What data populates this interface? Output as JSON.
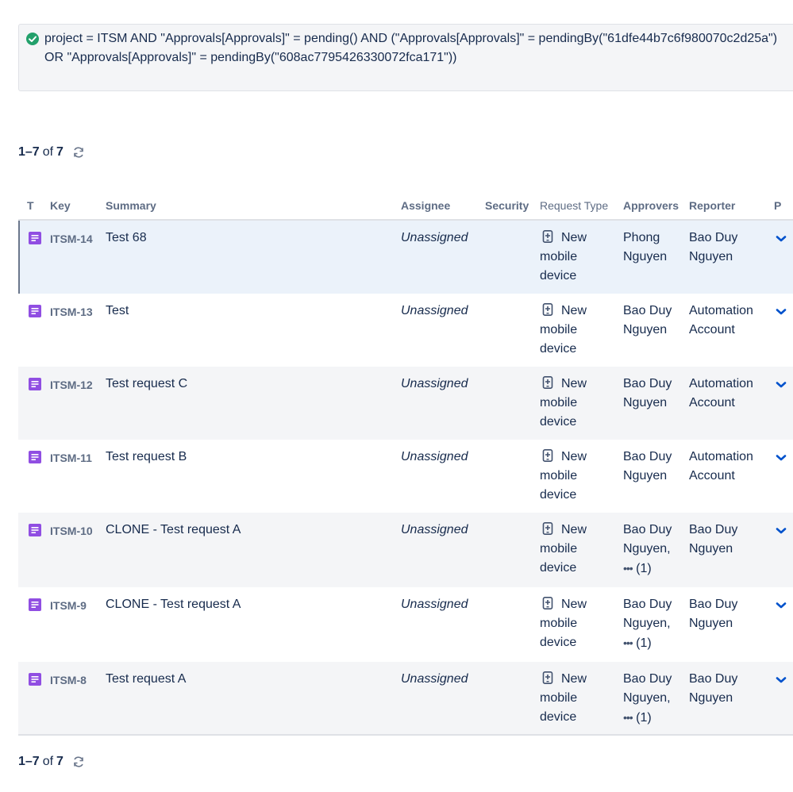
{
  "jql": {
    "query": "project = ITSM AND \"Approvals[Approvals]\" = pending() AND (\"Approvals[Approvals]\" = pendingBy(\"61dfe44b7c6f980070c2d25a\") OR \"Approvals[Approvals]\" = pendingBy(\"608ac7795426330072fca171\"))",
    "status_icon": "check-circle-icon",
    "status_color": "#22a06b"
  },
  "pager_top": {
    "range": "1–7",
    "of_label": "of",
    "total": "7"
  },
  "pager_bottom": {
    "range": "1–7",
    "of_label": "of",
    "total": "7"
  },
  "columns": {
    "type": "T",
    "key": "Key",
    "summary": "Summary",
    "assignee": "Assignee",
    "security": "Security",
    "request_type": "Request Type",
    "approvers": "Approvers",
    "reporter": "Reporter",
    "priority": "P"
  },
  "accent_color": "#0052cc",
  "issue_type_color": "#904ee2",
  "rows": [
    {
      "key": "ITSM-14",
      "summary": "Test 68",
      "assignee": "Unassigned",
      "request_type": "New mobile device",
      "approvers": "Phong Nguyen",
      "approvers_more": "",
      "reporter": "Bao Duy Nguyen"
    },
    {
      "key": "ITSM-13",
      "summary": "Test",
      "assignee": "Unassigned",
      "request_type": "New mobile device",
      "approvers": "Bao Duy Nguyen",
      "approvers_more": "",
      "reporter": "Automation Account"
    },
    {
      "key": "ITSM-12",
      "summary": "Test request C",
      "assignee": "Unassigned",
      "request_type": "New mobile device",
      "approvers": "Bao Duy Nguyen",
      "approvers_more": "",
      "reporter": "Automation Account"
    },
    {
      "key": "ITSM-11",
      "summary": "Test request B",
      "assignee": "Unassigned",
      "request_type": "New mobile device",
      "approvers": "Bao Duy Nguyen",
      "approvers_more": "",
      "reporter": "Automation Account"
    },
    {
      "key": "ITSM-10",
      "summary": "CLONE - Test request A",
      "assignee": "Unassigned",
      "request_type": "New mobile device",
      "approvers": "Bao Duy Nguyen,",
      "approvers_more": "(1)",
      "reporter": "Bao Duy Nguyen"
    },
    {
      "key": "ITSM-9",
      "summary": "CLONE - Test request A",
      "assignee": "Unassigned",
      "request_type": "New mobile device",
      "approvers": "Bao Duy Nguyen,",
      "approvers_more": "(1)",
      "reporter": "Bao Duy Nguyen"
    },
    {
      "key": "ITSM-8",
      "summary": "Test request A",
      "assignee": "Unassigned",
      "request_type": "New mobile device",
      "approvers": "Bao Duy Nguyen,",
      "approvers_more": "(1)",
      "reporter": "Bao Duy Nguyen"
    }
  ]
}
